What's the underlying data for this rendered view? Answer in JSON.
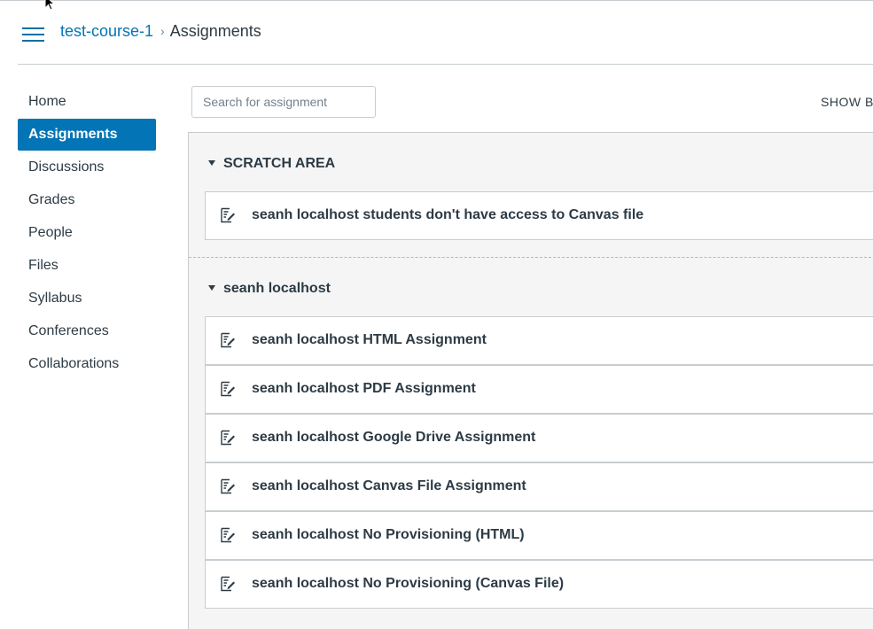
{
  "breadcrumb": {
    "course": "test-course-1",
    "current": "Assignments",
    "separator": "›"
  },
  "nav": {
    "items": [
      {
        "label": "Home"
      },
      {
        "label": "Assignments",
        "active": true
      },
      {
        "label": "Discussions"
      },
      {
        "label": "Grades"
      },
      {
        "label": "People"
      },
      {
        "label": "Files"
      },
      {
        "label": "Syllabus"
      },
      {
        "label": "Conferences"
      },
      {
        "label": "Collaborations"
      }
    ]
  },
  "search": {
    "placeholder": "Search for assignment",
    "value": ""
  },
  "toolbar": {
    "show_by_label": "SHOW BY"
  },
  "groups": [
    {
      "title": "SCRATCH AREA",
      "assignments": [
        "seanh localhost students don't have access to Canvas file"
      ]
    },
    {
      "title": "seanh localhost",
      "assignments": [
        "seanh localhost HTML Assignment",
        "seanh localhost PDF Assignment",
        "seanh localhost Google Drive Assignment",
        "seanh localhost Canvas File Assignment",
        "seanh localhost No Provisioning (HTML)",
        "seanh localhost No Provisioning (Canvas File)"
      ]
    }
  ],
  "icons": {
    "menu": "hamburger-menu-icon",
    "assignment": "assignment-icon",
    "collapse": "caret-down-icon"
  },
  "colors": {
    "accent": "#0374b5",
    "text": "#2d3b45",
    "border": "#c7cdd1",
    "group_bg": "#f5f5f5"
  }
}
